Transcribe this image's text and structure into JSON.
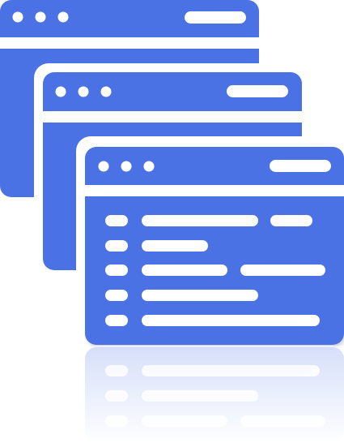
{
  "illustration": {
    "kind": "stacked-browser-windows-icon",
    "colors": {
      "window": "#4A72E5",
      "chrome_detail": "#ffffff",
      "background": "#ffffff"
    },
    "windows": [
      {
        "name": "back-window",
        "titlebar_dots": 3,
        "has_address_pill": true
      },
      {
        "name": "middle-window",
        "titlebar_dots": 3,
        "has_address_pill": true
      },
      {
        "name": "front-window",
        "titlebar_dots": 3,
        "has_address_pill": true,
        "content_rows": 5
      }
    ],
    "reflection": true
  }
}
